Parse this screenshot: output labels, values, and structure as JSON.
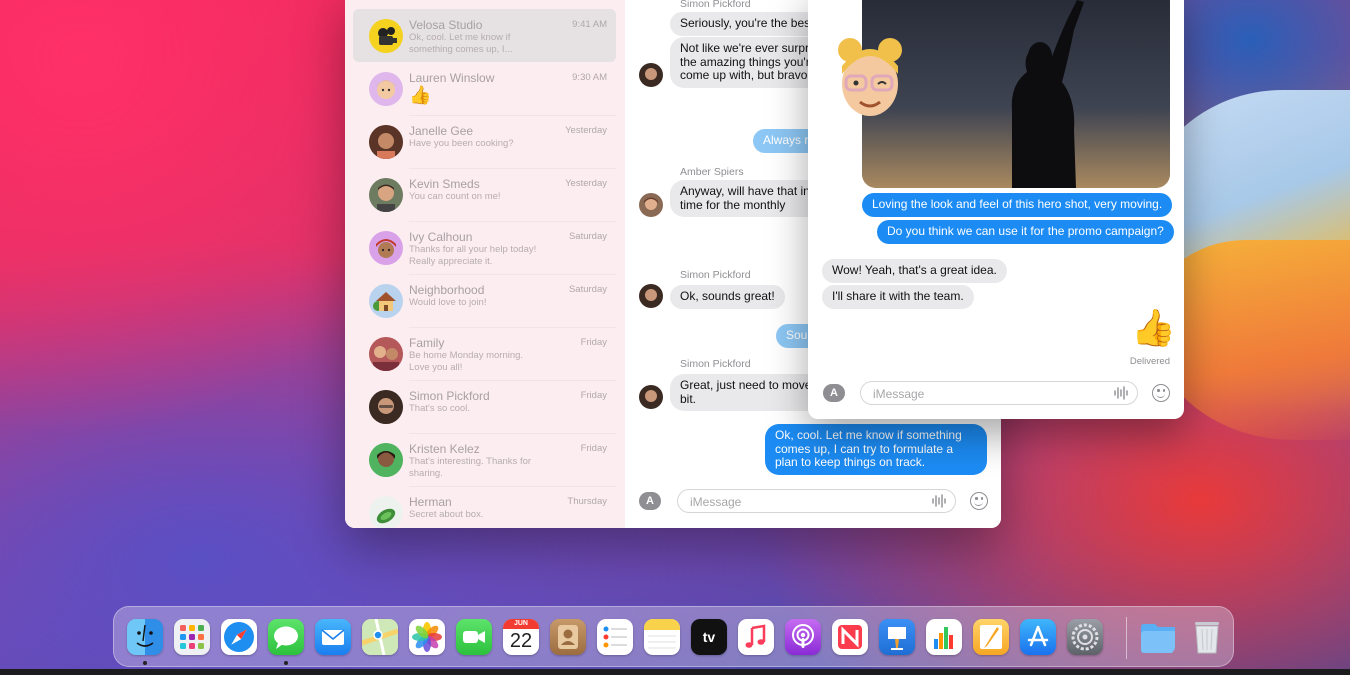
{
  "sidebar": {
    "conversations": [
      {
        "name": "Velosa Studio",
        "time": "9:41 AM",
        "preview": "Ok, cool. Let me know if something comes up, I...",
        "selected": true
      },
      {
        "name": "Lauren Winslow",
        "time": "9:30 AM",
        "preview": "👍"
      },
      {
        "name": "Janelle Gee",
        "time": "Yesterday",
        "preview": "Have you been cooking?"
      },
      {
        "name": "Kevin Smeds",
        "time": "Yesterday",
        "preview": "You can count on me!"
      },
      {
        "name": "Ivy Calhoun",
        "time": "Saturday",
        "preview": "Thanks for all your help today! Really appreciate it."
      },
      {
        "name": "Neighborhood",
        "time": "Saturday",
        "preview": "Would love to join!"
      },
      {
        "name": "Family",
        "time": "Friday",
        "preview": "Be home Monday morning. Love you all!"
      },
      {
        "name": "Simon Pickford",
        "time": "Friday",
        "preview": "That's so cool."
      },
      {
        "name": "Kristen Kelez",
        "time": "Friday",
        "preview": "That's interesting. Thanks for sharing."
      },
      {
        "name": "Herman",
        "time": "Thursday",
        "preview": "Secret about box."
      }
    ]
  },
  "chat": {
    "sender1": "Simon Pickford",
    "msg1": "Seriously, you're the best",
    "msg2": "Not like we're ever surprised by the amazing things you're able to come up with, but bravo...",
    "out1": "Always re",
    "sender2": "Amber Spiers",
    "msg3": "Anyway, will have that in just in time for the monthly",
    "sender3": "Simon Pickford",
    "msg4": "Ok, sounds great!",
    "out2": "Sounds",
    "sender4": "Simon Pickford",
    "msg5": "Great, just need to move a little bit.",
    "out3": "Ok, cool. Let me know if something comes up, I can try to formulate a plan to keep things on track.",
    "placeholder": "iMessage"
  },
  "overlay": {
    "out1": "Loving the look and feel of this hero shot, very moving.",
    "out2": "Do you think we can use it for the promo campaign?",
    "in1": "Wow! Yeah, that's a great idea.",
    "in2": "I'll share it with the team.",
    "reaction": "👍",
    "delivered": "Delivered",
    "placeholder": "iMessage"
  },
  "dock": {
    "calendar_month": "JUN",
    "calendar_day": "22",
    "tv_label": "tv",
    "apps": [
      "finder",
      "launchpad",
      "safari",
      "messages",
      "mail",
      "maps",
      "photos",
      "facetime",
      "calendar",
      "contacts",
      "reminders",
      "notes",
      "apple-tv",
      "music",
      "podcasts",
      "news",
      "keynote",
      "numbers",
      "pages",
      "app-store",
      "system-preferences",
      "downloads-folder",
      "trash"
    ]
  }
}
